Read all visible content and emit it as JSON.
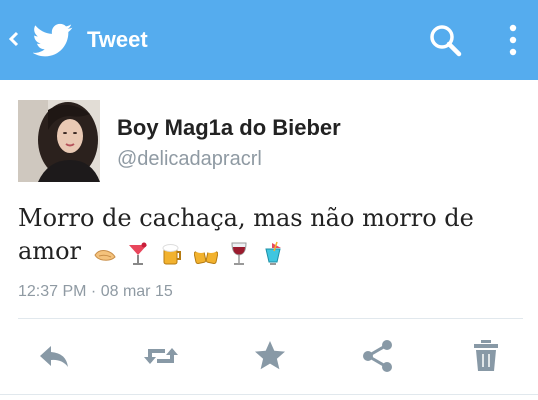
{
  "appbar": {
    "title": "Tweet",
    "color": "#55acee",
    "icons": [
      "back-chevron-icon",
      "twitter-bird-logo",
      "search-icon",
      "more-vertical-icon"
    ]
  },
  "tweet": {
    "display_name": "Boy Mag1a do Bieber",
    "handle": "@delicadapracrl",
    "text": "Morro de cachaça, mas não morro de amor",
    "emojis": [
      "clapping-hands-emoji",
      "cocktail-emoji",
      "beer-mug-emoji",
      "clinking-beers-emoji",
      "wine-glass-emoji",
      "tropical-drink-emoji"
    ],
    "timestamp": "12:37 PM · 08 mar 15"
  },
  "actions": [
    "reply-icon",
    "retweet-icon",
    "favorite-star-icon",
    "share-icon",
    "delete-trash-icon"
  ]
}
